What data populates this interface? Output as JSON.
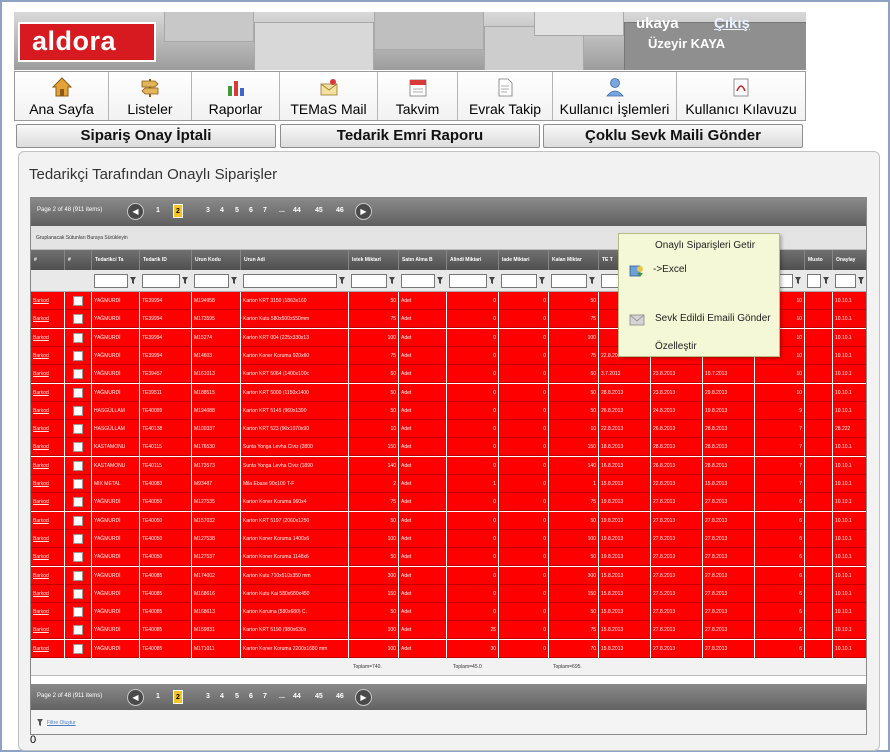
{
  "header": {
    "logo": "aldora",
    "user_login": "ukaya",
    "logout": "Çıkış",
    "user_full_name": "Üzeyir KAYA"
  },
  "menu": [
    {
      "label": "Ana Sayfa",
      "icon": "home-icon"
    },
    {
      "label": "Listeler",
      "icon": "signpost-icon"
    },
    {
      "label": "Raporlar",
      "icon": "bar-chart-icon"
    },
    {
      "label": "TEMaS Mail",
      "icon": "mail-icon"
    },
    {
      "label": "Takvim",
      "icon": "calendar-icon"
    },
    {
      "label": "Evrak Takip",
      "icon": "document-icon"
    },
    {
      "label": "Kullanıcı İşlemleri",
      "icon": "user-icon"
    },
    {
      "label": "Kullanıcı Kılavuzu",
      "icon": "pdf-icon"
    }
  ],
  "actions": {
    "cancel_approval": "Sipariş Onay İptali",
    "supply_report": "Tedarik Emri Raporu",
    "multi_mail": "Çoklu Sevk Maili Gönder"
  },
  "panel": {
    "title": "Tedarikçi Tarafından Onaylı Siparişler"
  },
  "grid": {
    "pager_info": "Page 2 of 48 (911 items)",
    "pages": [
      "1",
      "2",
      "3",
      "4",
      "5",
      "6",
      "7",
      "...",
      "44",
      "45",
      "46"
    ],
    "active_page": "2",
    "group_text": "Gruplanacak Sütunları Buraya Sürükleyin",
    "columns": [
      "#",
      "#",
      "Tedarikci Ta",
      "Tedarik ID",
      "Urun Kodu",
      "Urun Adi",
      "Istek Miktari",
      "Satın Alma B",
      "Alindi Miktari",
      "Iade Miktari",
      "Kalan Miktar",
      "TE T",
      "",
      "",
      "nc Gün",
      "Musto",
      "Onaylay"
    ],
    "rows": [
      {
        "link": "Barkod",
        "supplier": "YAĞMURDİ",
        "id": "TE39994",
        "code": "M194958",
        "name": "Karton KRT 3150 (1863x160",
        "qty": "50",
        "unit": "Adet",
        "recv": "0",
        "ret": "0",
        "rem": "50",
        "d1": "",
        "d2": "",
        "d3": "",
        "g": "10",
        "u": "10.10.1"
      },
      {
        "link": "Barkod",
        "supplier": "YAĞMURDİ",
        "id": "TE39994",
        "code": "M173595",
        "name": "Karton Kutu 580x500x550mm",
        "qty": "75",
        "unit": "Adet",
        "recv": "0",
        "ret": "0",
        "rem": "75",
        "d1": "",
        "d2": "",
        "d3": "",
        "g": "10",
        "u": "10.10.1"
      },
      {
        "link": "Barkod",
        "supplier": "YAĞMURDİ",
        "id": "TE39994",
        "code": "M15274",
        "name": "Karton KRT 004 (225x330x13",
        "qty": "100",
        "unit": "Adet",
        "recv": "0",
        "ret": "0",
        "rem": "100",
        "d1": "",
        "d2": "",
        "d3": "",
        "g": "10",
        "u": "10.10.1"
      },
      {
        "link": "Barkod",
        "supplier": "YAĞMURDİ",
        "id": "TE39994",
        "code": "M14603",
        "name": "Karton Koner Koruma 920x60",
        "qty": "75",
        "unit": "Adet",
        "recv": "0",
        "ret": "0",
        "rem": "75",
        "d1": "22.8.2013",
        "d2": "",
        "d3": "",
        "g": "10",
        "u": "10.10.1"
      },
      {
        "link": "Barkod",
        "supplier": "YAĞMURDİ",
        "id": "TE39457",
        "code": "M161013",
        "name": "Karton KRT 5064 (1400x100c",
        "qty": "50",
        "unit": "Adet",
        "recv": "0",
        "ret": "0",
        "rem": "50",
        "d1": "3.7.2013",
        "d2": "23.8.2013",
        "d3": "10.7.2013",
        "g": "10",
        "u": "10.10.1"
      },
      {
        "link": "Barkod",
        "supplier": "YAĞMURDİ",
        "id": "TE39511",
        "code": "M188515",
        "name": "Karton KRT 5000 (1150x1400",
        "qty": "50",
        "unit": "Adet",
        "recv": "0",
        "ret": "0",
        "rem": "50",
        "d1": "28.8.2013",
        "d2": "23.8.2013",
        "d3": "29.8.2013",
        "g": "10",
        "u": "10.10.1"
      },
      {
        "link": "Barkod",
        "supplier": "HASGÜLLAM",
        "id": "TE40099",
        "code": "M194088",
        "name": "Karton KRT 5145 (960x1390",
        "qty": "50",
        "unit": "Adet",
        "recv": "0",
        "ret": "0",
        "rem": "50",
        "d1": "26.8.2013",
        "d2": "24.8.2013",
        "d3": "19.8.2013",
        "g": "9",
        "u": "10.10.1"
      },
      {
        "link": "Barkod",
        "supplier": "HASGÜLLAM",
        "id": "TE40138",
        "code": "M100337",
        "name": "Karton KRT 523 (90x1070x90",
        "qty": "10",
        "unit": "Adet",
        "recv": "0",
        "ret": "0",
        "rem": "10",
        "d1": "22.8.2013",
        "d2": "26.8.2013",
        "d3": "28.8.2013",
        "g": "7",
        "u": "28.222"
      },
      {
        "link": "Barkod",
        "supplier": "KASTAMONU",
        "id": "TE40115",
        "code": "M176530",
        "name": "Sunta Yonga Levha Civiz (2800",
        "qty": "150",
        "unit": "Adet",
        "recv": "0",
        "ret": "0",
        "rem": "150",
        "d1": "18.8.2013",
        "d2": "28.8.2013",
        "d3": "28.8.2013",
        "g": "7",
        "u": "10.10.1"
      },
      {
        "link": "Barkod",
        "supplier": "KASTAMONU",
        "id": "TE40115",
        "code": "M173573",
        "name": "Sunta Yonga Levha Civiz (1890",
        "qty": "140",
        "unit": "Adet",
        "recv": "0",
        "ret": "0",
        "rem": "140",
        "d1": "16.8.2013",
        "d2": "26.8.2013",
        "d3": "28.8.2013",
        "g": "7",
        "u": "10.10.1"
      },
      {
        "link": "Barkod",
        "supplier": "MIX METAL",
        "id": "TE40083",
        "code": "M93487",
        "name": "Mila Ebase 90x100 T-F",
        "qty": "2",
        "unit": "Adet",
        "recv": "1",
        "ret": "0",
        "rem": "1",
        "d1": "15.8.2013",
        "d2": "22.8.2013",
        "d3": "15.8.2013",
        "g": "7",
        "u": "10.10.1"
      },
      {
        "link": "Barkod",
        "supplier": "YAĞMURDİ",
        "id": "TE40050",
        "code": "M127535",
        "name": "Karton Koner Koruma 960x4",
        "qty": "75",
        "unit": "Adet",
        "recv": "0",
        "ret": "0",
        "rem": "75",
        "d1": "19.8.2013",
        "d2": "27.8.2013",
        "d3": "27.8.2013",
        "g": "6",
        "u": "10.10.1"
      },
      {
        "link": "Barkod",
        "supplier": "YAĞMURDİ",
        "id": "TE40050",
        "code": "M157032",
        "name": "Karton KRT 5197 (2060x1250",
        "qty": "50",
        "unit": "Adet",
        "recv": "0",
        "ret": "0",
        "rem": "50",
        "d1": "19.8.2013",
        "d2": "27.8.2013",
        "d3": "27.8.2013",
        "g": "6",
        "u": "10.10.1"
      },
      {
        "link": "Barkod",
        "supplier": "YAĞMURDİ",
        "id": "TE40050",
        "code": "M127538",
        "name": "Karton Koner Koruma 1400x6",
        "qty": "100",
        "unit": "Adet",
        "recv": "0",
        "ret": "0",
        "rem": "100",
        "d1": "19.8.2013",
        "d2": "27.8.2013",
        "d3": "27.8.2013",
        "g": "6",
        "u": "10.10.1"
      },
      {
        "link": "Barkod",
        "supplier": "YAĞMURDİ",
        "id": "TE40050",
        "code": "M127537",
        "name": "Karton Koner Koruma 1148x6",
        "qty": "50",
        "unit": "Adet",
        "recv": "0",
        "ret": "0",
        "rem": "50",
        "d1": "19.8.2013",
        "d2": "27.8.2013",
        "d3": "27.8.2013",
        "g": "6",
        "u": "10.10.1"
      },
      {
        "link": "Barkod",
        "supplier": "YAĞMURDİ",
        "id": "TE40085",
        "code": "M174002",
        "name": "Karton Kutu 710x510x350 mm",
        "qty": "300",
        "unit": "Adet",
        "recv": "0",
        "ret": "0",
        "rem": "300",
        "d1": "15.8.2013",
        "d2": "27.8.2013",
        "d3": "27.8.2013",
        "g": "6",
        "u": "10.10.1"
      },
      {
        "link": "Barkod",
        "supplier": "YAĞMURDİ",
        "id": "TE40085",
        "code": "M168616",
        "name": "Karton Kutu Kai 580x680x450",
        "qty": "150",
        "unit": "Adet",
        "recv": "0",
        "ret": "0",
        "rem": "150",
        "d1": "15.8.2013",
        "d2": "27.5.2013",
        "d3": "27.8.2013",
        "g": "6",
        "u": "10.10.1"
      },
      {
        "link": "Barkod",
        "supplier": "YAĞMURDİ",
        "id": "TE40085",
        "code": "M168613",
        "name": "Karton Koruma (580x680) C.",
        "qty": "50",
        "unit": "Adet",
        "recv": "0",
        "ret": "0",
        "rem": "50",
        "d1": "15.8.2013",
        "d2": "27.8.2013",
        "d3": "27.8.2013",
        "g": "6",
        "u": "10.10.1"
      },
      {
        "link": "Barkod",
        "supplier": "YAĞMURDİ",
        "id": "TE40085",
        "code": "M159831",
        "name": "Karton KRT 5190 (980x630x",
        "qty": "100",
        "unit": "Adet",
        "recv": "25",
        "ret": "0",
        "rem": "75",
        "d1": "15.8.2013",
        "d2": "27.8.2013",
        "d3": "27.8.2013",
        "g": "6",
        "u": "10.10.1"
      },
      {
        "link": "Barkod",
        "supplier": "YAĞMURDİ",
        "id": "TE40085",
        "code": "M171011",
        "name": "Karton Koner Koruma 2200x1680 mm",
        "qty": "100",
        "unit": "Adet",
        "recv": "30",
        "ret": "0",
        "rem": "70",
        "d1": "15.8.2013",
        "d2": "27.8.2013",
        "d3": "27.8.2013",
        "g": "6",
        "u": "10.10.1"
      }
    ],
    "totals": [
      "Toplam=740.",
      "Toplam=45.0",
      "Toplam=695."
    ],
    "filter_create": "Filtre Oluştur"
  },
  "context_menu": {
    "items": [
      "Onaylı Siparişleri Getir",
      "->Excel",
      "Sevk Edildi Emaili Gönder",
      "Özelleştir"
    ]
  },
  "status": "0",
  "colors": {
    "brand_red": "#d71920",
    "row_red": "#ff0000",
    "header_gray": "#5f5f5f",
    "context_bg": "#f5f8d6"
  }
}
